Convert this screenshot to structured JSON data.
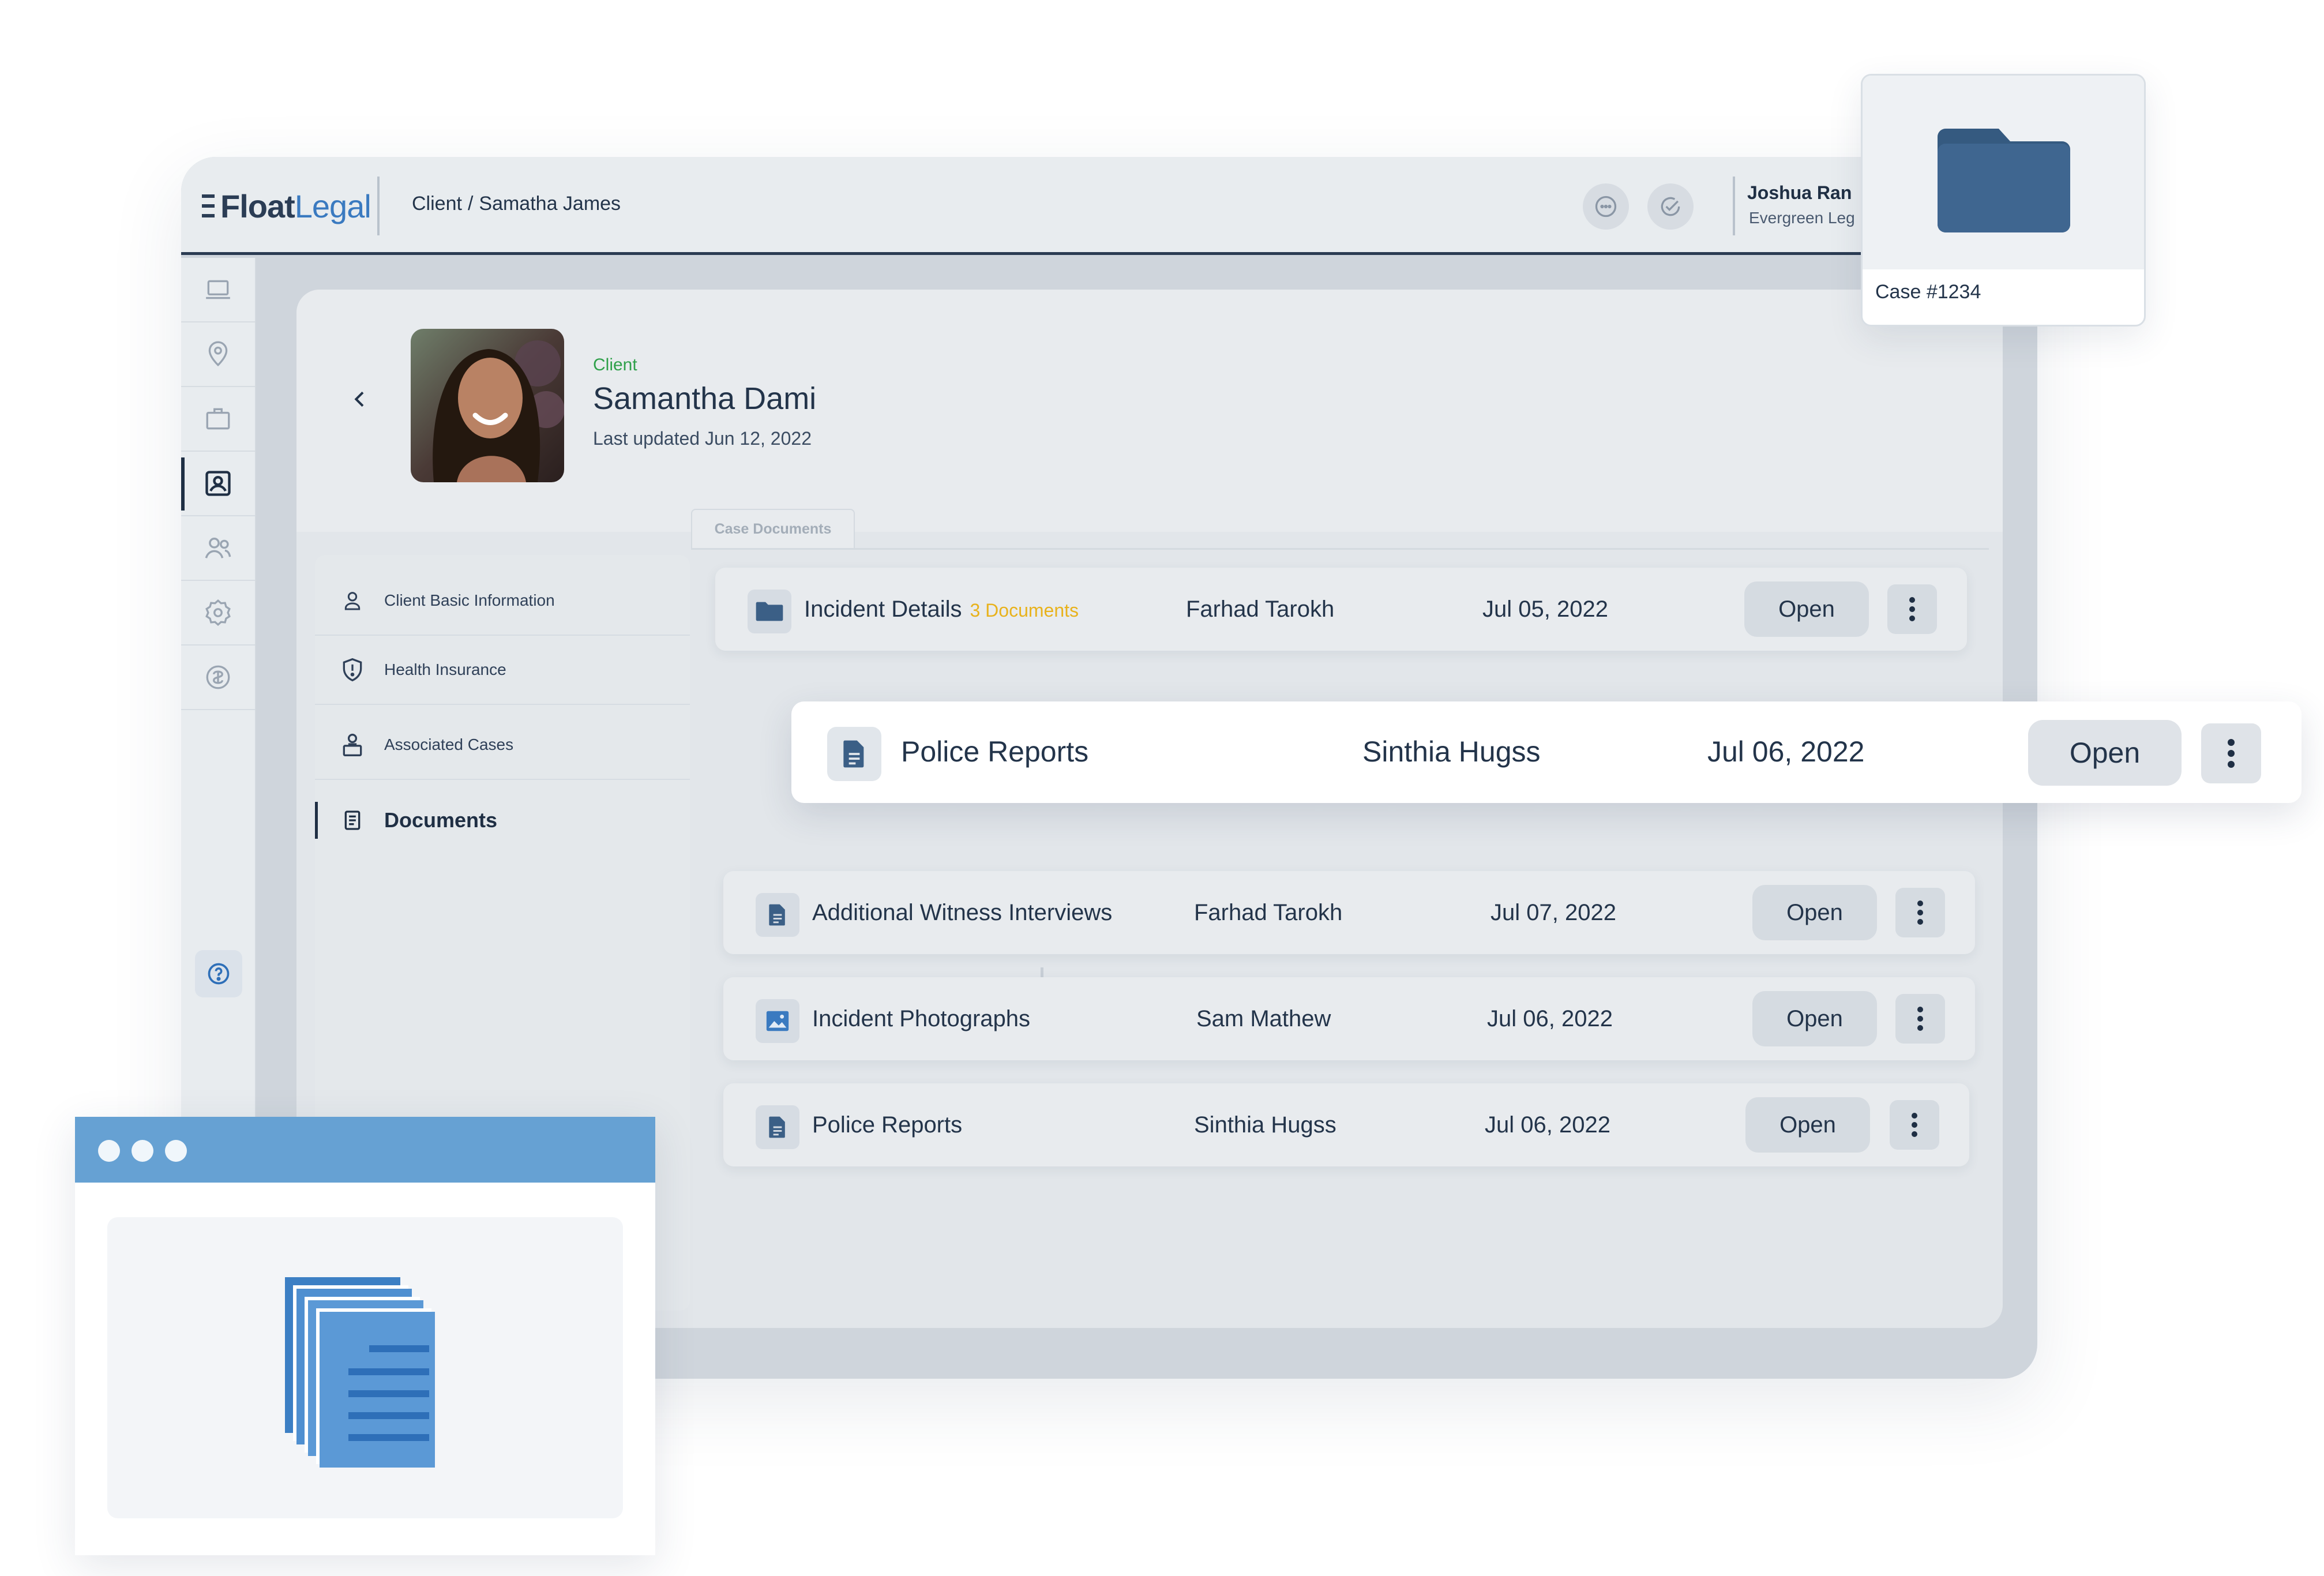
{
  "app": {
    "logo_bold": "Float",
    "logo_light": "Legal",
    "breadcrumb": {
      "section": "Client",
      "separator": "/",
      "name": "Samatha James"
    },
    "user": {
      "name": "Joshua Ran",
      "org": "Evergreen Leg"
    }
  },
  "client": {
    "role": "Client",
    "name": "Samantha Dami",
    "updated": "Last updated Jun 12, 2022"
  },
  "left_nav": [
    {
      "label": "Client Basic Information",
      "icon": "person-icon"
    },
    {
      "label": "Health Insurance",
      "icon": "shield-alert-icon"
    },
    {
      "label": "Associated Cases",
      "icon": "user-briefcase-icon"
    },
    {
      "label": "Documents",
      "icon": "document-icon",
      "active": true
    }
  ],
  "tab": {
    "label": "Case Documents"
  },
  "documents": [
    {
      "title": "Incident Details",
      "badge": "3 Documents",
      "owner": "Farhad Tarokh",
      "date": "Jul 05, 2022",
      "action": "Open",
      "icon": "folder-icon"
    },
    {
      "title": "Additional Witness Interviews",
      "owner": "Farhad Tarokh",
      "date": "Jul 07, 2022",
      "action": "Open",
      "icon": "file-text-icon"
    },
    {
      "title": "Incident Photographs",
      "owner": "Sam Mathew",
      "date": "Jul 06, 2022",
      "action": "Open",
      "icon": "image-icon"
    },
    {
      "title": "Police Reports",
      "owner": "Sinthia Hugss",
      "date": "Jul 06, 2022",
      "action": "Open",
      "icon": "file-text-icon"
    }
  ],
  "floating_row": {
    "title": "Police Reports",
    "owner": "Sinthia Hugss",
    "date": "Jul 06, 2022",
    "action": "Open"
  },
  "case_card": {
    "label": "Case #1234"
  },
  "colors": {
    "accent_blue": "#3a7ac0",
    "folder_blue": "#3b5f86",
    "badge_yellow": "#e8b21c",
    "role_green": "#2fa04a",
    "browser_bar": "#66a1d3"
  }
}
